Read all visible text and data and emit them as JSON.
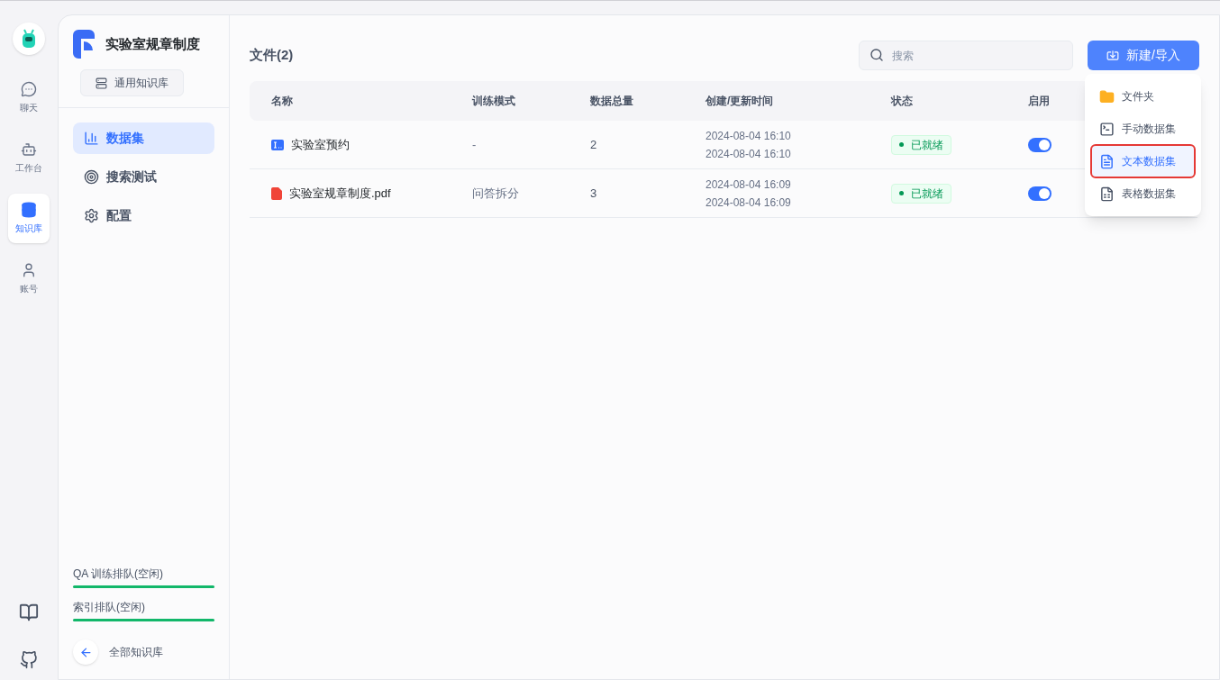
{
  "rail": {
    "items": [
      {
        "label": "聊天",
        "kind": "chat",
        "selected": false
      },
      {
        "label": "工作台",
        "kind": "bot",
        "selected": false
      },
      {
        "label": "知识库",
        "kind": "database",
        "selected": true
      },
      {
        "label": "账号",
        "kind": "user",
        "selected": false
      }
    ],
    "bottom": [
      {
        "kind": "book"
      },
      {
        "kind": "github"
      }
    ]
  },
  "sidebar": {
    "title": "实验室规章制度",
    "type_button": "通用知识库",
    "items": [
      {
        "label": "数据集",
        "kind": "chart",
        "selected": true
      },
      {
        "label": "搜索测试",
        "kind": "target",
        "selected": false
      },
      {
        "label": "配置",
        "kind": "gear",
        "selected": false
      }
    ],
    "queues": [
      {
        "label": "QA 训练排队(空闲)",
        "level": 1
      },
      {
        "label": "索引排队(空闲)",
        "level": 1
      }
    ],
    "back": "全部知识库"
  },
  "header": {
    "title": "文件(2)",
    "search": {
      "placeholder": "搜索"
    },
    "button": "新建/导入"
  },
  "table": {
    "columns": [
      "名称",
      "训练模式",
      "数据总量",
      "创建/更新时间",
      "状态",
      "启用"
    ],
    "rows": [
      {
        "kind": "manual",
        "name": "实验室预约",
        "mode": "-",
        "count": "2",
        "created": "2024-08-04 16:10",
        "updated": "2024-08-04 16:10",
        "status": "已就绪",
        "on": true
      },
      {
        "kind": "pdf",
        "name": "实验室规章制度.pdf",
        "mode": "问答拆分",
        "count": "3",
        "created": "2024-08-04 16:09",
        "updated": "2024-08-04 16:09",
        "status": "已就绪",
        "on": true
      }
    ]
  },
  "menu": {
    "items": [
      {
        "label": "文件夹",
        "kind": "folder",
        "selected": false
      },
      {
        "label": "手动数据集",
        "kind": "manual",
        "selected": false
      },
      {
        "label": "文本数据集",
        "kind": "text",
        "selected": true
      },
      {
        "label": "表格数据集",
        "kind": "csv",
        "selected": false
      }
    ]
  }
}
